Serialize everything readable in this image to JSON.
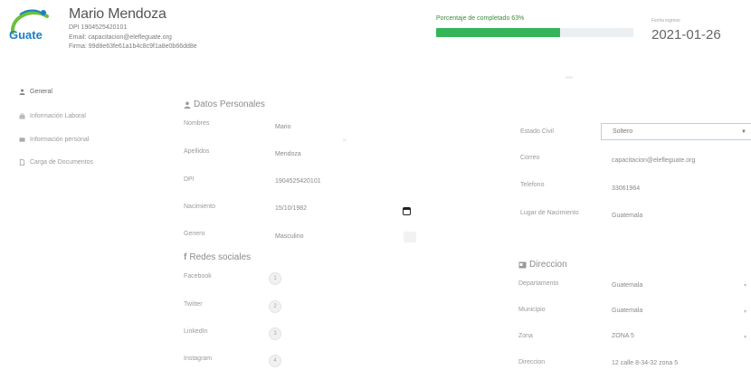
{
  "header": {
    "logo_text": "Guate",
    "name": "Mario Mendoza",
    "line1": "DPI 1904525420101",
    "line2": "Email: capacitacion@elefleguate.org",
    "line3": "Firma: 99d8e63fe61a1b4c8c9f1a8e0b66dd8e"
  },
  "progress": {
    "label": "Porcentaje de completado 63%",
    "value": 63,
    "color": "#35b559"
  },
  "date": {
    "label": "Fecha ingreso",
    "value": "2021-01-26"
  },
  "sidebar": {
    "items": [
      {
        "label": "General",
        "icon": "user-icon",
        "active": true
      },
      {
        "label": "Información Laboral",
        "icon": "briefcase-icon",
        "active": false
      },
      {
        "label": "Información personal",
        "icon": "id-card-icon",
        "active": false
      },
      {
        "label": "Carga de Documentos",
        "icon": "document-icon",
        "active": false
      }
    ]
  },
  "personal": {
    "title": "Datos Personales",
    "rows": [
      {
        "label": "Nombres",
        "value": "Mario"
      },
      {
        "label": "Apellidos",
        "value": "Mendoza"
      },
      {
        "label": "DPI",
        "value": "1904525420101"
      },
      {
        "label": "Nacimiento",
        "value": "15/10/1982"
      },
      {
        "label": "Genero",
        "value": "Masculino"
      }
    ]
  },
  "social": {
    "title": "Redes sociales",
    "rows": [
      {
        "label": "Facebook",
        "badge": "1"
      },
      {
        "label": "Twitter",
        "badge": "2"
      },
      {
        "label": "LinkedIn",
        "badge": "3"
      },
      {
        "label": "Instagram",
        "badge": "4"
      }
    ]
  },
  "contact": {
    "rows": [
      {
        "label": "Estado Civil",
        "value": "Soltero"
      },
      {
        "label": "Correo",
        "value": "capacitacion@elefleguate.org"
      },
      {
        "label": "Telefono",
        "value": "33061964"
      },
      {
        "label": "Lugar de Nacimiento",
        "value": "Guatemala"
      }
    ]
  },
  "address": {
    "title": "Direccion",
    "rows": [
      {
        "label": "Departamento",
        "value": "Guatemala"
      },
      {
        "label": "Municipio",
        "value": "Guatemala"
      },
      {
        "label": "Zona",
        "value": "ZONA 5"
      },
      {
        "label": "Direccion",
        "value": "12 calle 8-34-32 zona 5"
      }
    ]
  },
  "colors": {
    "accent": "#35b559",
    "logo_blue": "#1b7fc4",
    "logo_green": "#6cbf3c"
  }
}
